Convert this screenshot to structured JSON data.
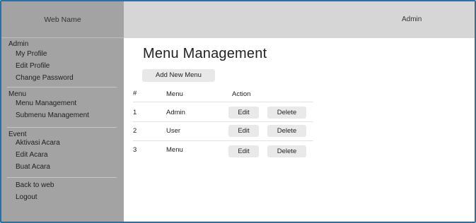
{
  "sidebar": {
    "brand": "Web Name",
    "sections": [
      {
        "title": "Admin",
        "items": [
          "My Profile",
          "Edit Profile",
          "Change Password"
        ]
      },
      {
        "title": "Menu",
        "items": [
          "Menu Management",
          "Submenu Management"
        ]
      },
      {
        "title": "Event",
        "items": [
          "Aktivasi Acara",
          "Edit Acara",
          "Buat Acara"
        ]
      },
      {
        "title": "",
        "items": [
          "Back to web",
          "Logout"
        ]
      }
    ]
  },
  "topbar": {
    "user": "Admin"
  },
  "main": {
    "title": "Menu Management",
    "add_button": "Add New Menu",
    "table": {
      "headers": [
        "#",
        "Menu",
        "Action"
      ],
      "rows": [
        {
          "num": "1",
          "menu": "Admin",
          "edit": "Edit",
          "delete": "Delete"
        },
        {
          "num": "2",
          "menu": "User",
          "edit": "Edit",
          "delete": "Delete"
        },
        {
          "num": "3",
          "menu": "Menu",
          "edit": "Edit",
          "delete": "Delete"
        }
      ]
    }
  },
  "colors": {
    "sidebar_bg": "#a3a3a3",
    "topbar_bg": "#d6d6d6",
    "button_bg": "#e9e9e9",
    "frame": "#2f6f9f"
  }
}
